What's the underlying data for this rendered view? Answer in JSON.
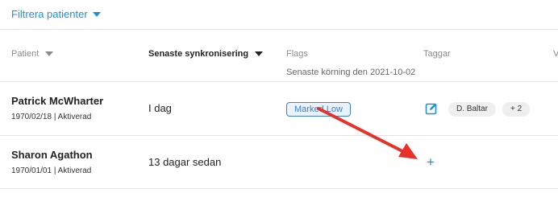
{
  "filter": {
    "label": "Filtrera patienter"
  },
  "table": {
    "headers": {
      "patient": "Patient",
      "sync": "Senaste synkronisering",
      "flags": "Flags",
      "flags_sub": "Senaste körning den 2021-10-02",
      "tags": "Taggar",
      "more": "V"
    },
    "rows": [
      {
        "name": "Patrick McWharter",
        "meta": "1970/02/18 | Aktiverad",
        "sync": "I dag",
        "flag": "Marked Low",
        "tags": [
          "D. Baltar",
          "+ 2"
        ]
      },
      {
        "name": "Sharon Agathon",
        "meta": "1970/01/01 | Aktiverad",
        "sync": "13 dagar sedan",
        "add_tag": "+"
      }
    ]
  },
  "colors": {
    "accent": "#1e90d6",
    "flag": "#3b7fd1",
    "annotation_arrow": "#e8312a"
  }
}
